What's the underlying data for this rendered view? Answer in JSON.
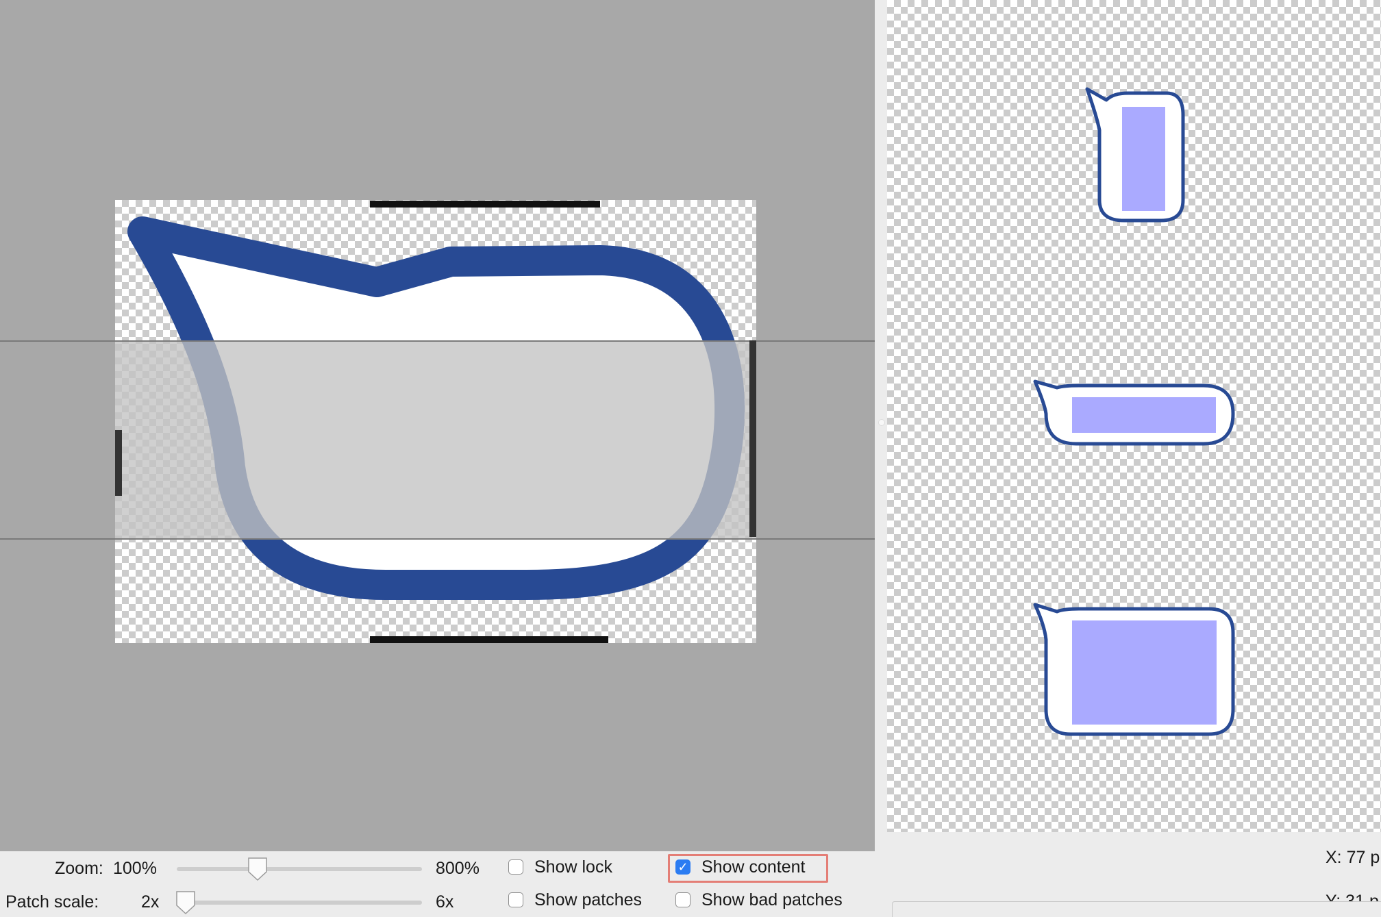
{
  "editor": {
    "zoom_label": "Zoom:",
    "zoom_value": "100%",
    "zoom_max": "800%",
    "zoom_level": 0.33,
    "patch_scale_label": "Patch scale:",
    "patch_scale_min": "2x",
    "patch_scale_max": "6x",
    "patch_scale_level": 0.0
  },
  "options": {
    "show_lock": {
      "label": "Show lock",
      "checked": false
    },
    "show_content": {
      "label": "Show content",
      "checked": true
    },
    "show_patches": {
      "label": "Show patches",
      "checked": false
    },
    "show_bad_patches": {
      "label": "Show bad patches",
      "checked": false
    }
  },
  "status": {
    "x_readout": "X: 77 p",
    "y_readout": "Y: 31 p"
  },
  "colors": {
    "editor_background": "#a8a8a8",
    "bubble_stroke": "#284a94",
    "content_fill": "#aaaaff",
    "highlight": "#e47e76"
  },
  "icons": {
    "checkmark": "checkmark-icon"
  }
}
